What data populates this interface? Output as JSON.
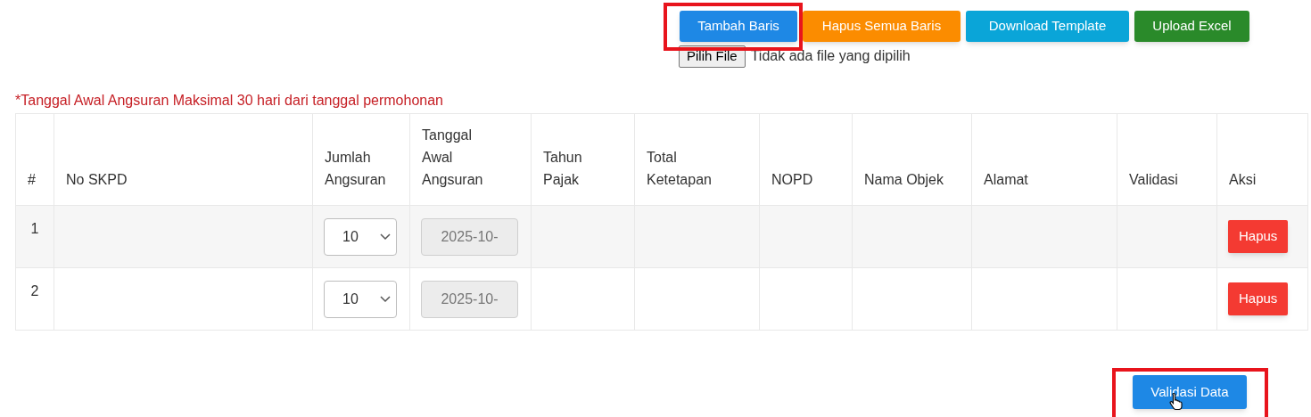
{
  "toolbar": [
    {
      "label": "Tambah Baris",
      "color": "#1e88e5",
      "highlighted": true
    },
    {
      "label": "Hapus Semua Baris",
      "color": "#fb8c00",
      "highlighted": false
    },
    {
      "label": "Download Template",
      "color": "#0aa5d8",
      "highlighted": false
    },
    {
      "label": "Upload Excel",
      "color": "#2a8a2a",
      "highlighted": false
    }
  ],
  "file_input": {
    "button": "Pilih File",
    "status": "Tidak ada file yang dipilih"
  },
  "note": "*Tanggal Awal Angsuran Maksimal 30 hari dari tanggal permohonan",
  "table": {
    "columns": [
      "#",
      "No SKPD",
      "Jumlah Angsuran",
      "Tanggal Awal Angsuran",
      "Tahun Pajak",
      "Total Ketetapan",
      "NOPD",
      "Nama Objek",
      "Alamat",
      "Validasi",
      "Aksi"
    ],
    "rows": [
      {
        "number": "1",
        "jumlah_angsuran": "10",
        "tanggal_awal": "2025-10-",
        "tanggal_disabled": true,
        "action": "Hapus"
      },
      {
        "number": "2",
        "jumlah_angsuran": "10",
        "tanggal_awal": "2025-10-",
        "tanggal_disabled": true,
        "action": "Hapus"
      }
    ]
  },
  "submit": {
    "label": "Validasi Data",
    "highlighted": true
  }
}
